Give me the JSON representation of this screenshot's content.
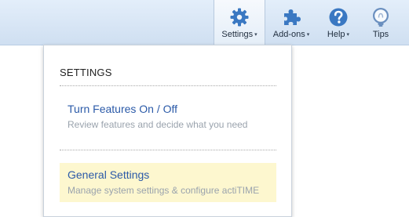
{
  "nav": {
    "items": [
      {
        "label": "Settings",
        "icon": "gear-icon",
        "has_caret": true,
        "active": true
      },
      {
        "label": "Add-ons",
        "icon": "puzzle-icon",
        "has_caret": true,
        "active": false
      },
      {
        "label": "Help",
        "icon": "help-icon",
        "has_caret": true,
        "active": false
      },
      {
        "label": "Tips",
        "icon": "lightbulb-icon",
        "has_caret": false,
        "active": false
      }
    ],
    "caret_glyph": "▾"
  },
  "dropdown": {
    "heading": "SETTINGS",
    "items": [
      {
        "title": "Turn Features On / Off",
        "description": "Review features and decide what you need"
      },
      {
        "title": "General Settings",
        "description": "Manage system settings & configure actiTIME"
      }
    ]
  },
  "colors": {
    "accent": "#2b5aa8",
    "icon_blue": "#3a78c2",
    "highlight": "#fdf7cf"
  }
}
